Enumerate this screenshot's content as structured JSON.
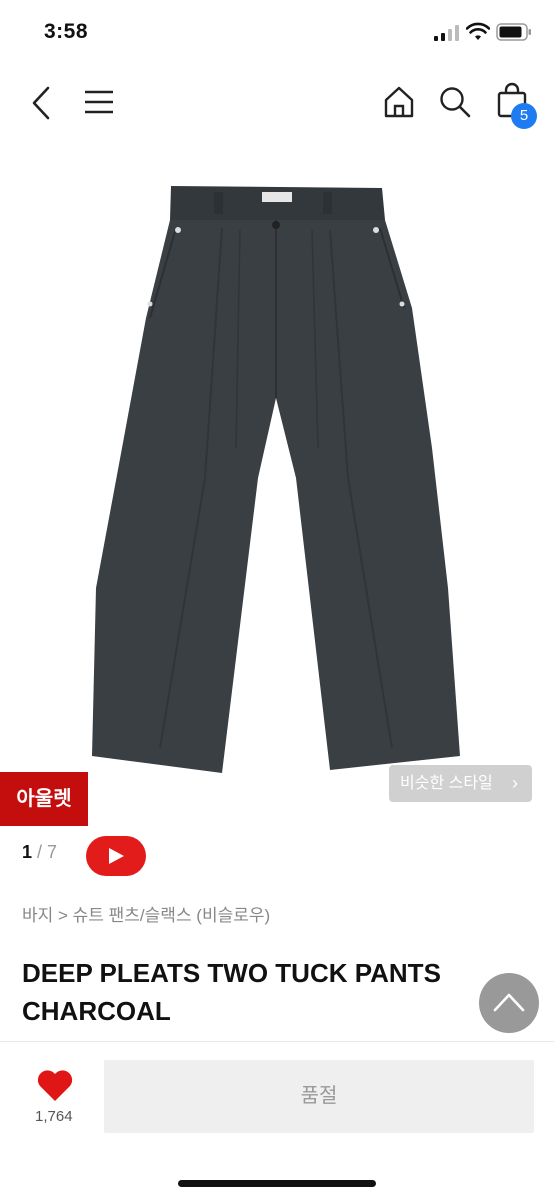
{
  "status": {
    "time": "3:58"
  },
  "nav": {
    "cart_count": "5"
  },
  "product": {
    "outlet_label": "아울렛",
    "similar_style_label": "비슷한 스타일",
    "image_index": "1",
    "image_total": "7",
    "breadcrumb": "바지 > 슈트 팬츠/슬랙스 (비슬로우)",
    "title": "DEEP PLEATS TWO TUCK PANTS CHARCOAL"
  },
  "bottom_bar": {
    "like_count": "1,764",
    "buy_button_label": "품절"
  },
  "colors": {
    "accent": "#c40d0d",
    "badge": "#1e7bf2",
    "video": "#e21b1b",
    "product": "#3a3f44"
  },
  "icons": [
    "back-icon",
    "menu-icon",
    "home-icon",
    "search-icon",
    "cart-icon",
    "play-icon",
    "chevron-up-icon",
    "heart-icon"
  ]
}
